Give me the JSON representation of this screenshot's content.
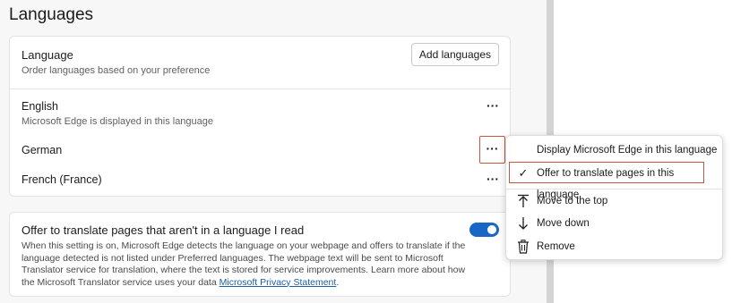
{
  "page": {
    "title": "Languages"
  },
  "language_card": {
    "title": "Language",
    "subtitle": "Order languages based on your preference",
    "add_button": "Add languages",
    "items": [
      {
        "name": "English",
        "note": "Microsoft Edge is displayed in this language"
      },
      {
        "name": "German",
        "note": ""
      },
      {
        "name": "French (France)",
        "note": ""
      }
    ],
    "more_label": "···"
  },
  "translate_card": {
    "title": "Offer to translate pages that aren't in a language I read",
    "description": "When this setting is on, Microsoft Edge detects the language on your webpage and offers to translate if the language detected is not listed under Preferred languages. The webpage text will be sent to Microsoft Translator service for translation, where the text is stored for service improvements. Learn more about how the Microsoft Translator service uses your data",
    "link_text": "Microsoft Privacy Statement",
    "trailing": ".",
    "toggle_on": true
  },
  "context_menu": {
    "items": [
      {
        "label": "Display Microsoft Edge in this language",
        "icon": ""
      },
      {
        "label": "Offer to translate pages in this language",
        "icon": "✓",
        "checked": true
      },
      {
        "label": "Move to the top",
        "icon": "⤒"
      },
      {
        "label": "Move down",
        "icon": "↓"
      },
      {
        "label": "Remove",
        "icon": "trash-icon"
      }
    ]
  },
  "colors": {
    "accent": "#1a66c7",
    "highlight": "#c8553d",
    "link": "#1a5fa8"
  }
}
